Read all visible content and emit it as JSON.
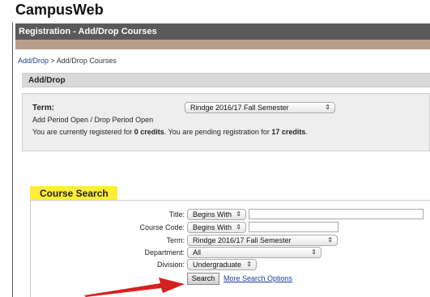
{
  "app": {
    "title": "CampusWeb"
  },
  "header": {
    "title": "Registration - Add/Drop Courses"
  },
  "breadcrumb": {
    "link": "Add/Drop",
    "separator": " > ",
    "current": "Add/Drop Courses"
  },
  "section": {
    "title": "Add/Drop"
  },
  "term_panel": {
    "label": "Term:",
    "selected": "Rindge 2016/17 Fall Semester",
    "period_status": "Add Period Open / Drop Period Open",
    "reg_prefix": "You are currently registered for ",
    "registered_credits": "0 credits",
    "reg_middle": ". You are pending registration for ",
    "pending_credits": "17 credits",
    "reg_suffix": "."
  },
  "course_search": {
    "tab_label": "Course Search",
    "title_label": "Title:",
    "title_mode": "Begins With",
    "title_value": "",
    "code_label": "Course Code:",
    "code_mode": "Begins With",
    "code_value": "",
    "term_label": "Term:",
    "term_value": "Rindge 2016/17 Fall Semester",
    "department_label": "Department:",
    "department_value": "All",
    "division_label": "Division:",
    "division_value": "Undergraduate",
    "search_button": "Search",
    "more_options": "More Search Options"
  },
  "colors": {
    "header_bar": "#5a5a5a",
    "header_stripe": "#b89e8a",
    "tab_highlight": "#ffee33",
    "link": "#1a3c9c",
    "arrow": "#d62020"
  },
  "icons": {
    "select_chevron": "updown-chevron-icon",
    "annotation": "red-arrow-icon"
  }
}
